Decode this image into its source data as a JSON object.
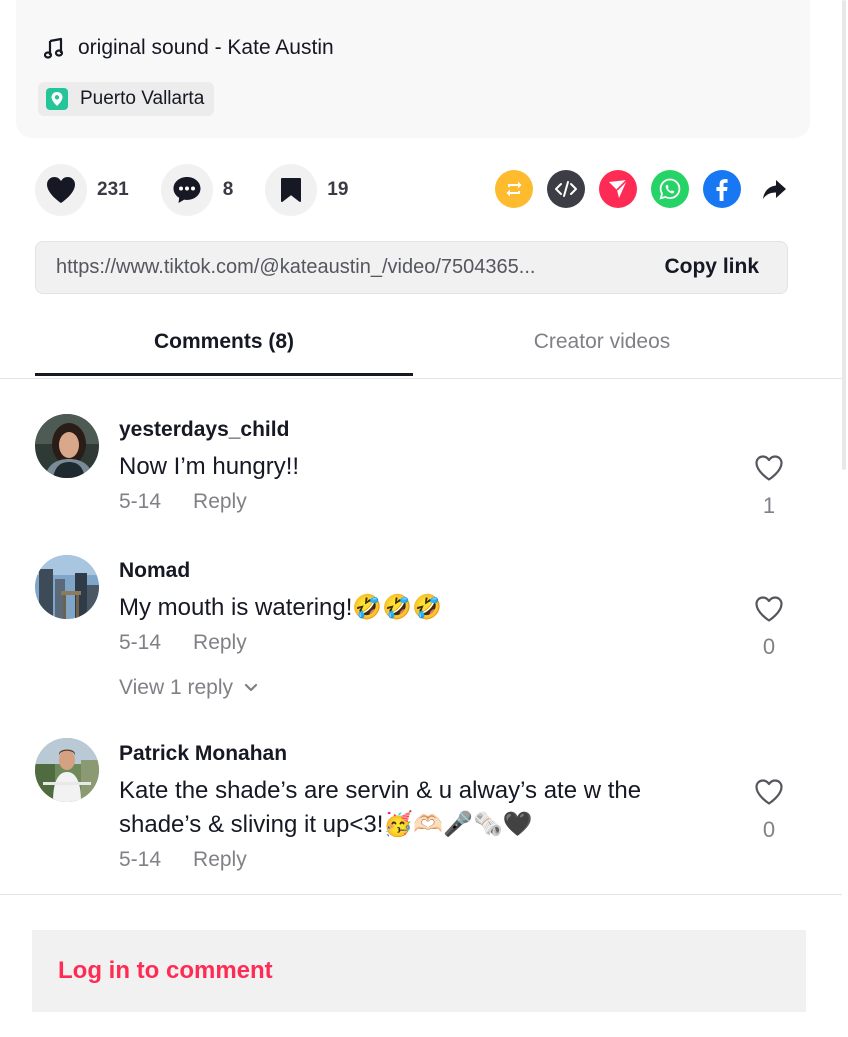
{
  "description": {
    "music_label": "original sound - Kate Austin",
    "location_label": "Puerto Vallarta"
  },
  "actions": {
    "likes": "231",
    "comments": "8",
    "saves": "19"
  },
  "share": {
    "icons": [
      "repost-icon",
      "embed-icon",
      "send-icon",
      "whatsapp-icon",
      "facebook-icon",
      "share-arrow-icon"
    ],
    "colors": {
      "repost": "#fdbb2d",
      "embed": "#3c3d45",
      "send": "#fe2c55",
      "whatsapp": "#25d366",
      "facebook": "#1877f2"
    }
  },
  "link": {
    "url": "https://www.tiktok.com/@kateaustin_/video/7504365...",
    "copy_label": "Copy link"
  },
  "tabs": {
    "comments_label": "Comments (8)",
    "creator_label": "Creator videos"
  },
  "comments": [
    {
      "username": "yesterdays_child",
      "text": "Now I’m hungry!!",
      "date": "5-14",
      "reply_label": "Reply",
      "likes": "1"
    },
    {
      "username": "Nomad",
      "text": "My mouth is watering!🤣🤣🤣",
      "date": "5-14",
      "reply_label": "Reply",
      "likes": "0",
      "view_replies_label": "View 1 reply"
    },
    {
      "username": "Patrick Monahan",
      "text": "Kate the shade’s are servin & u alway’s ate w the shade’s & sliving it up<3!🥳🫶🏻🎤🗞️🖤",
      "date": "5-14",
      "reply_label": "Reply",
      "likes": "0"
    }
  ],
  "footer": {
    "login_label": "Log in to comment",
    "accent_color": "#fe2c55"
  }
}
